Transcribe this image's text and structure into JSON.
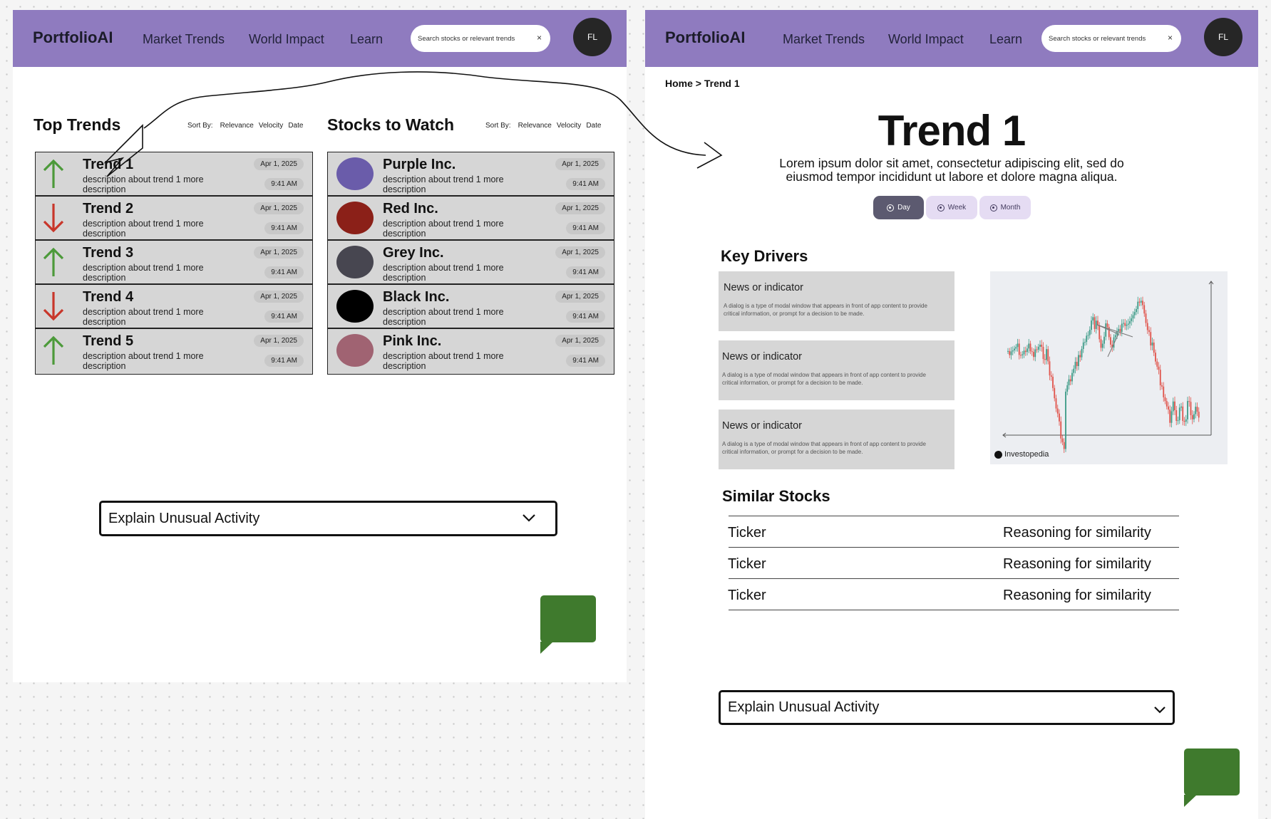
{
  "nav": {
    "logo": "PortfolioAI",
    "links": [
      "Market Trends",
      "World Impact",
      "Learn"
    ],
    "search_placeholder": "Search stocks or relevant trends",
    "clear_symbol": "×",
    "avatar_initials": "FL",
    "color": "#8f7bbf"
  },
  "home": {
    "top_trends": {
      "title": "Top Trends",
      "sort": {
        "label": "Sort By:",
        "options": [
          "Relevance",
          "Velocity",
          "Date"
        ]
      },
      "items": [
        {
          "title": "Trend 1",
          "desc": "description about trend 1 more description",
          "direction": "up",
          "date": "Apr 1, 2025",
          "time": "9:41 AM"
        },
        {
          "title": "Trend 2",
          "desc": "description about trend 1 more description",
          "direction": "down",
          "date": "Apr 1, 2025",
          "time": "9:41 AM"
        },
        {
          "title": "Trend 3",
          "desc": "description about trend 1 more description",
          "direction": "up",
          "date": "Apr 1, 2025",
          "time": "9:41 AM"
        },
        {
          "title": "Trend 4",
          "desc": "description about trend 1 more description",
          "direction": "down",
          "date": "Apr 1, 2025",
          "time": "9:41 AM"
        },
        {
          "title": "Trend 5",
          "desc": "description about trend 1 more description",
          "direction": "up",
          "date": "Apr 1, 2025",
          "time": "9:41 AM"
        }
      ]
    },
    "stocks": {
      "title": "Stocks to Watch",
      "sort": {
        "label": "Sort By:",
        "options": [
          "Relevance",
          "Velocity",
          "Date"
        ]
      },
      "items": [
        {
          "title": "Purple Inc.",
          "desc": "description about trend 1 more description",
          "color": "#6a5caa",
          "date": "Apr 1, 2025",
          "time": "9:41 AM"
        },
        {
          "title": "Red Inc.",
          "desc": "description about trend 1 more description",
          "color": "#8b2018",
          "date": "Apr 1, 2025",
          "time": "9:41 AM"
        },
        {
          "title": "Grey Inc.",
          "desc": "description about trend 1 more description",
          "color": "#474650",
          "date": "Apr 1, 2025",
          "time": "9:41 AM"
        },
        {
          "title": "Black Inc.",
          "desc": "description about trend 1 more description",
          "color": "#000000",
          "date": "Apr 1, 2025",
          "time": "9:41 AM"
        },
        {
          "title": "Pink Inc.",
          "desc": "description about trend 1 more description",
          "color": "#a06372",
          "date": "Apr 1, 2025",
          "time": "9:41 AM"
        }
      ]
    },
    "explain_dropdown": "Explain Unusual Activity"
  },
  "detail": {
    "breadcrumb": "Home > Trend 1",
    "title": "Trend 1",
    "description": "Lorem ipsum dolor sit amet, consectetur adipiscing elit, sed do eiusmod tempor incididunt ut labore et dolore magna aliqua.",
    "ranges": [
      {
        "label": "Day",
        "active": true
      },
      {
        "label": "Week",
        "active": false
      },
      {
        "label": "Month",
        "active": false
      }
    ],
    "key_drivers": {
      "title": "Key Drivers",
      "cards": [
        {
          "title": "News or indicator",
          "body": "A dialog is a type of modal window that appears in front of app content to provide critical information, or prompt for a decision to be made."
        },
        {
          "title": "News or indicator",
          "body": "A dialog is a type of modal window that appears in front of app content to provide critical information, or prompt for a decision to be made."
        },
        {
          "title": "News or indicator",
          "body": "A dialog is a type of modal window that appears in front of app content to provide critical information, or prompt for a decision to be made."
        }
      ],
      "chart_credit": "Investopedia"
    },
    "similar": {
      "title": "Similar Stocks",
      "rows": [
        {
          "ticker": "Ticker",
          "reason": "Reasoning for similarity"
        },
        {
          "ticker": "Ticker",
          "reason": "Reasoning for similarity"
        },
        {
          "ticker": "Ticker",
          "reason": "Reasoning for similarity"
        }
      ]
    },
    "explain_dropdown": "Explain Unusual Activity"
  },
  "colors": {
    "up_arrow": "#4c9a3a",
    "down_arrow": "#c8362a",
    "chat_button": "#3f7a2d",
    "active_range": "#5c5a70",
    "inactive_range": "#e5dcf3"
  }
}
